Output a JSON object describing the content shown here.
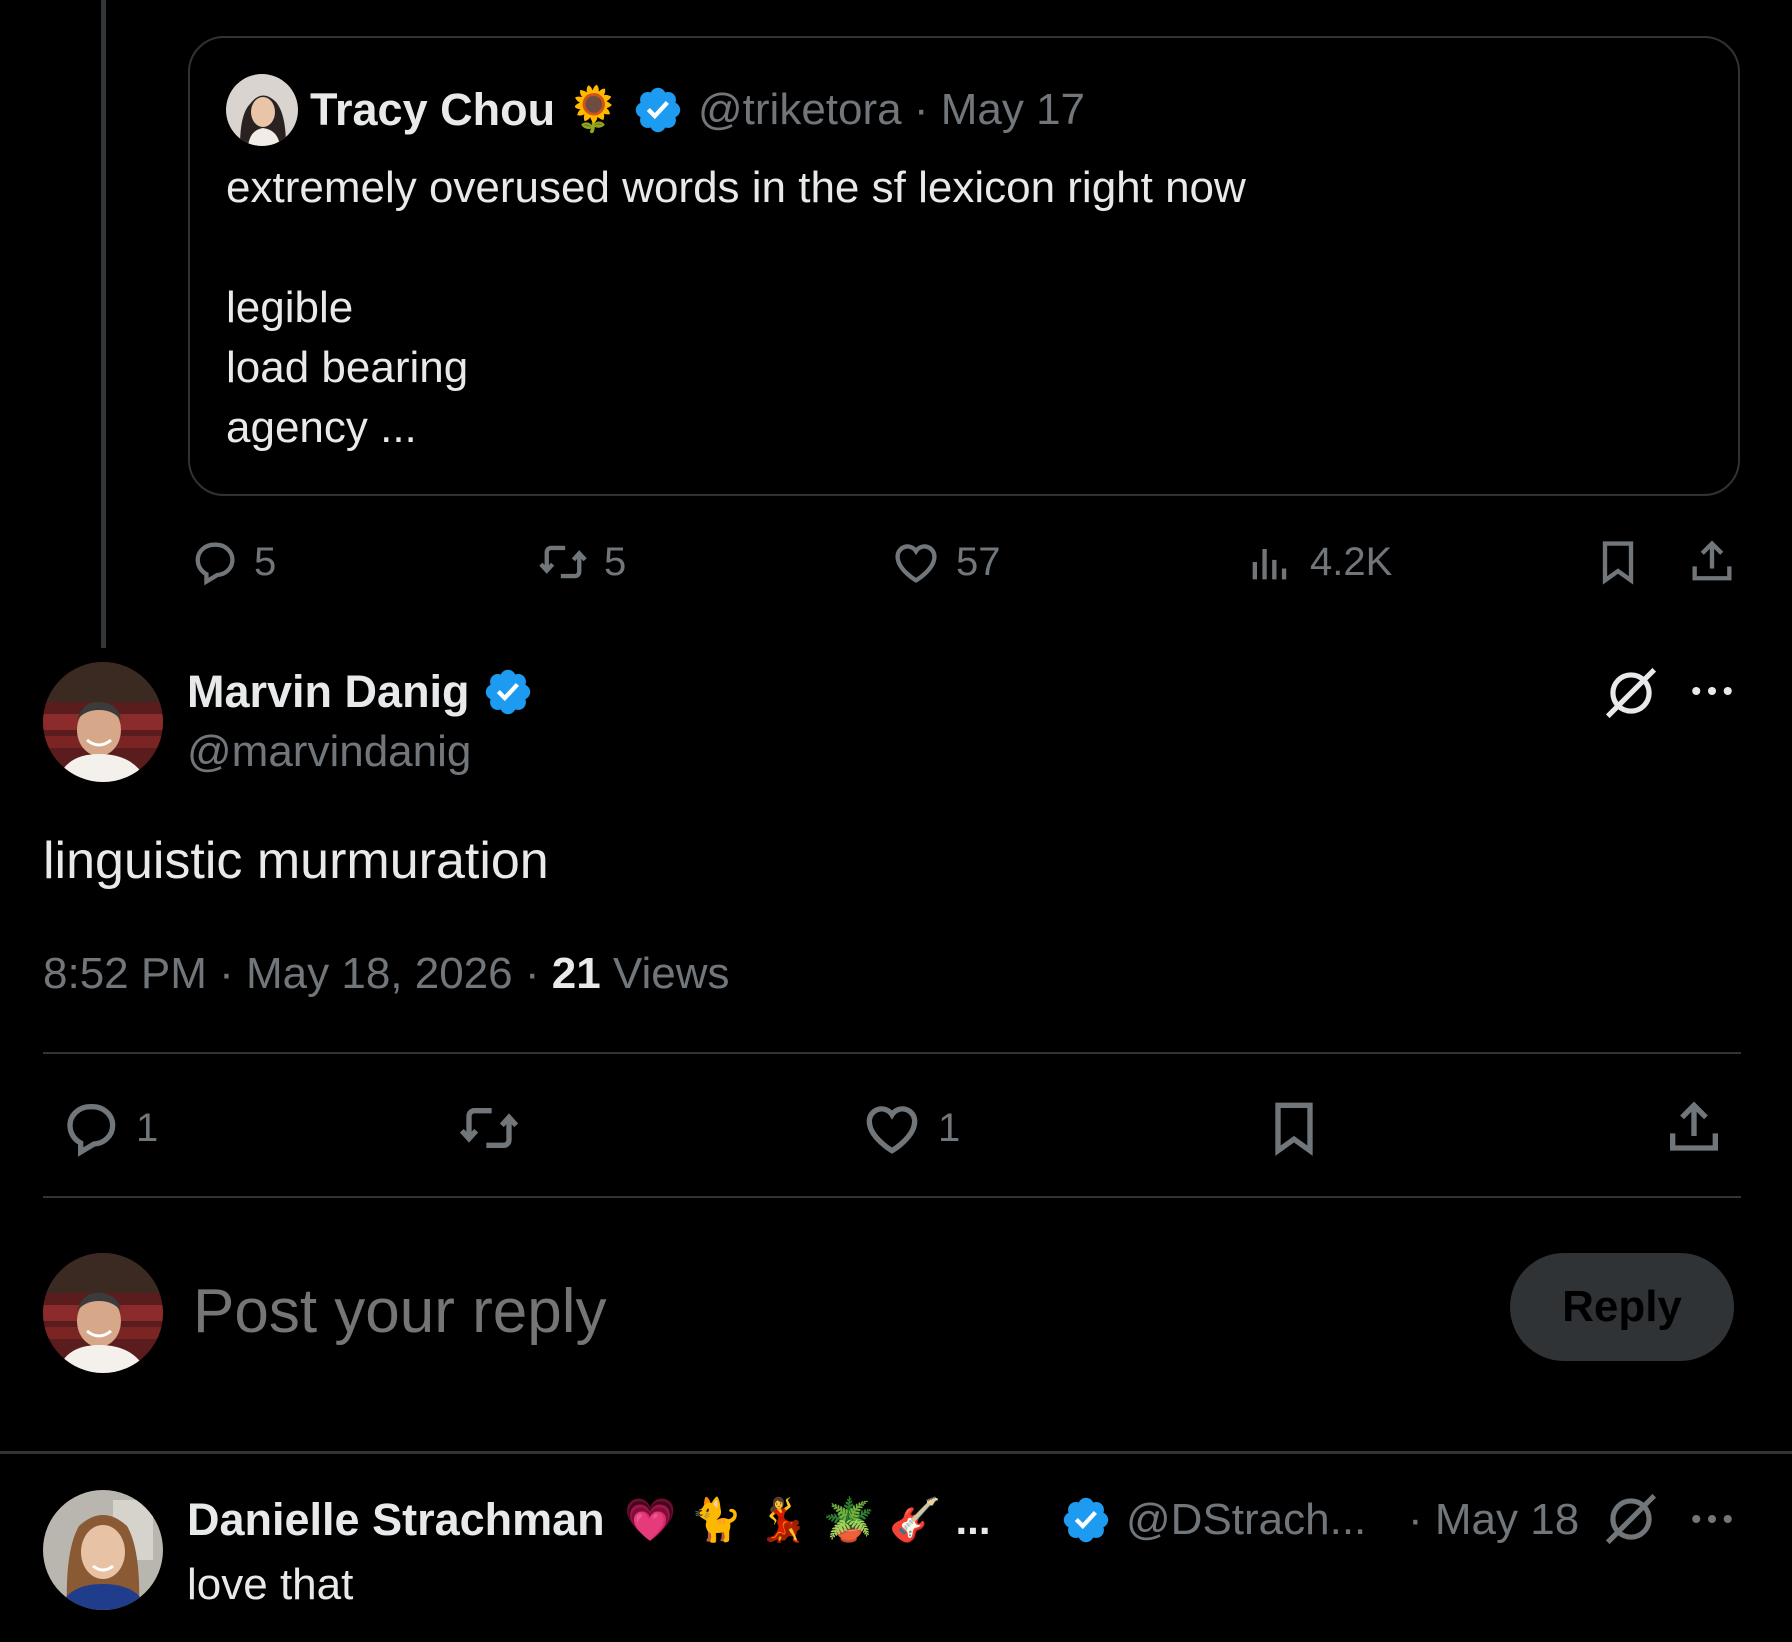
{
  "quoted_post": {
    "author_name": "Tracy Chou",
    "name_emoji": "🌻",
    "handle": "@triketora",
    "separator": "·",
    "date": "May 17",
    "text": "extremely overused words in the sf lexicon right now\n\nlegible\nload bearing\nagency ...",
    "stats": {
      "replies": "5",
      "reposts": "5",
      "likes": "57",
      "views": "4.2K"
    }
  },
  "main_post": {
    "author_name": "Marvin Danig",
    "handle": "@marvindanig",
    "text": "linguistic murmuration",
    "time": "8:52 PM",
    "date": "May 18, 2026",
    "views_count": "21",
    "views_label": "Views",
    "separator": "·",
    "actions": {
      "replies": "1",
      "likes": "1"
    }
  },
  "reply_box": {
    "placeholder": "Post your reply",
    "button_label": "Reply"
  },
  "reply_post": {
    "author_name": "Danielle Strachman",
    "name_emojis": "💗🐈💃🪴🎸",
    "name_ellipsis": "...",
    "handle": "@DStrach...",
    "date": "· May 18",
    "text": "love that"
  },
  "colors": {
    "background": "#000000",
    "text": "#e7e9ea",
    "muted": "#71767b",
    "verified": "#1d9bf0",
    "border": "#2f3336"
  }
}
